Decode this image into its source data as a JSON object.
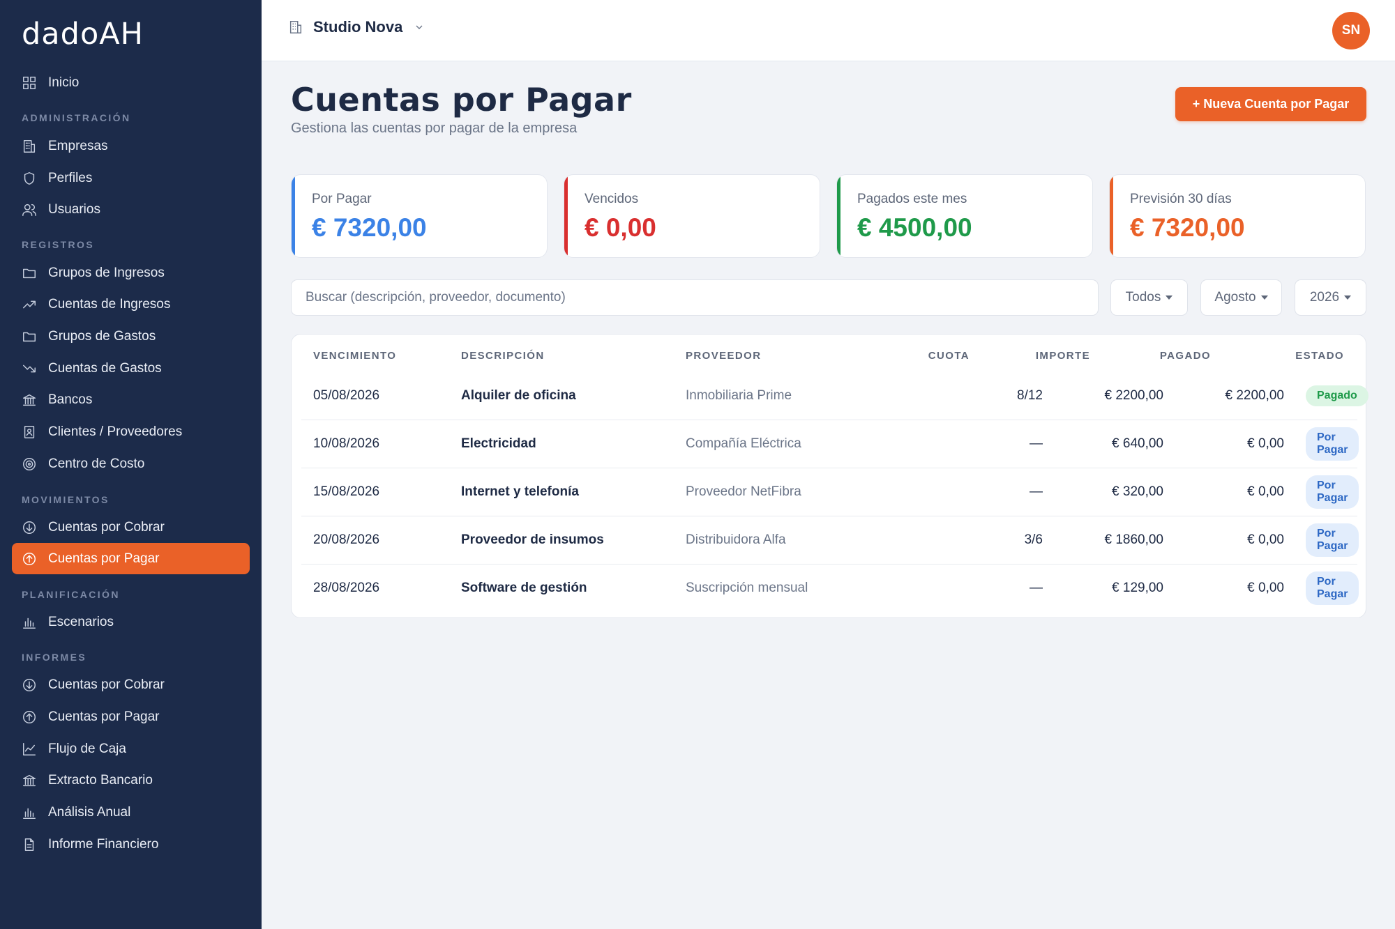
{
  "app": {
    "logo": "dadoAH"
  },
  "sidebar": {
    "top": [
      {
        "label": "Inicio",
        "icon": "grid-icon"
      }
    ],
    "sections": [
      {
        "title": "ADMINISTRACIÓN",
        "items": [
          {
            "label": "Empresas",
            "icon": "building-icon"
          },
          {
            "label": "Perfiles",
            "icon": "shield-icon"
          },
          {
            "label": "Usuarios",
            "icon": "users-icon"
          }
        ]
      },
      {
        "title": "REGISTROS",
        "items": [
          {
            "label": "Grupos de Ingresos",
            "icon": "folder-icon"
          },
          {
            "label": "Cuentas de Ingresos",
            "icon": "trend-up-icon"
          },
          {
            "label": "Grupos de Gastos",
            "icon": "folder-icon"
          },
          {
            "label": "Cuentas de Gastos",
            "icon": "trend-down-icon"
          },
          {
            "label": "Bancos",
            "icon": "bank-icon"
          },
          {
            "label": "Clientes / Proveedores",
            "icon": "contact-icon"
          },
          {
            "label": "Centro de Costo",
            "icon": "target-icon"
          }
        ]
      },
      {
        "title": "MOVIMIENTOS",
        "items": [
          {
            "label": "Cuentas por Cobrar",
            "icon": "arrow-down-circle-icon"
          },
          {
            "label": "Cuentas por Pagar",
            "icon": "arrow-up-circle-icon",
            "active": true
          }
        ]
      },
      {
        "title": "PLANIFICACIÓN",
        "items": [
          {
            "label": "Escenarios",
            "icon": "bar-chart-icon"
          }
        ]
      },
      {
        "title": "INFORMES",
        "items": [
          {
            "label": "Cuentas por Cobrar",
            "icon": "arrow-down-circle-icon"
          },
          {
            "label": "Cuentas por Pagar",
            "icon": "arrow-up-circle-icon"
          },
          {
            "label": "Flujo de Caja",
            "icon": "line-chart-icon"
          },
          {
            "label": "Extracto Bancario",
            "icon": "bank-icon"
          },
          {
            "label": "Análisis Anual",
            "icon": "bar-chart-icon"
          },
          {
            "label": "Informe Financiero",
            "icon": "document-icon"
          }
        ]
      }
    ]
  },
  "topbar": {
    "company": "Studio Nova",
    "avatar_initials": "SN"
  },
  "page": {
    "title": "Cuentas por Pagar",
    "subtitle": "Gestiona las cuentas por pagar de la empresa",
    "new_button": "+ Nueva Cuenta por Pagar"
  },
  "cards": [
    {
      "label": "Por Pagar",
      "value": "€ 7320,00",
      "color": "#3b82e6"
    },
    {
      "label": "Vencidos",
      "value": "€ 0,00",
      "color": "#d92f2f"
    },
    {
      "label": "Pagados este mes",
      "value": "€ 4500,00",
      "color": "#1f9a4a"
    },
    {
      "label": "Previsión 30 días",
      "value": "€ 7320,00",
      "color": "#ea6128"
    }
  ],
  "filters": {
    "search_placeholder": "Buscar (descripción, proveedor, documento)",
    "status": "Todos",
    "month": "Agosto",
    "year": "2026"
  },
  "table": {
    "headers": [
      "VENCIMIENTO",
      "DESCRIPCIÓN",
      "PROVEEDOR",
      "CUOTA",
      "IMPORTE",
      "PAGADO",
      "ESTADO"
    ],
    "rows": [
      {
        "vencimiento": "05/08/2026",
        "descripcion": "Alquiler de oficina",
        "proveedor": "Inmobiliaria Prime",
        "cuota": "8/12",
        "importe": "€ 2200,00",
        "pagado": "€ 2200,00",
        "estado": "Pagado",
        "estado_type": "pagado"
      },
      {
        "vencimiento": "10/08/2026",
        "descripcion": "Electricidad",
        "proveedor": "Compañía Eléctrica",
        "cuota": "—",
        "importe": "€ 640,00",
        "pagado": "€ 0,00",
        "estado": "Por Pagar",
        "estado_type": "porpagar"
      },
      {
        "vencimiento": "15/08/2026",
        "descripcion": "Internet y telefonía",
        "proveedor": "Proveedor NetFibra",
        "cuota": "—",
        "importe": "€ 320,00",
        "pagado": "€ 0,00",
        "estado": "Por Pagar",
        "estado_type": "porpagar"
      },
      {
        "vencimiento": "20/08/2026",
        "descripcion": "Proveedor de insumos",
        "proveedor": "Distribuidora Alfa",
        "cuota": "3/6",
        "importe": "€ 1860,00",
        "pagado": "€ 0,00",
        "estado": "Por Pagar",
        "estado_type": "porpagar"
      },
      {
        "vencimiento": "28/08/2026",
        "descripcion": "Software de gestión",
        "proveedor": "Suscripción mensual",
        "cuota": "—",
        "importe": "€ 129,00",
        "pagado": "€ 0,00",
        "estado": "Por Pagar",
        "estado_type": "porpagar"
      }
    ]
  }
}
